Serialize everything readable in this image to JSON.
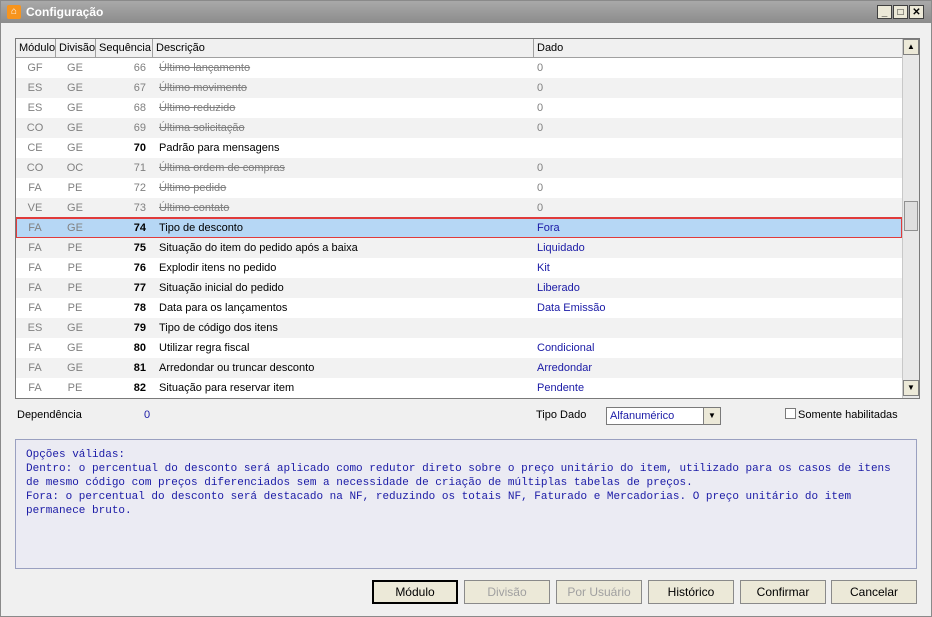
{
  "window": {
    "title": "Configuração"
  },
  "grid": {
    "columns": [
      "Módulo",
      "Divisão",
      "Sequência",
      "Descrição",
      "Dado"
    ],
    "rows": [
      {
        "mod": "GF",
        "div": "GE",
        "seq": "66",
        "desc": "Último lançamento",
        "val": "0",
        "state": "inactive"
      },
      {
        "mod": "ES",
        "div": "GE",
        "seq": "67",
        "desc": "Último movimento",
        "val": "0",
        "state": "inactive"
      },
      {
        "mod": "ES",
        "div": "GE",
        "seq": "68",
        "desc": "Último reduzido",
        "val": "0",
        "state": "inactive"
      },
      {
        "mod": "CO",
        "div": "GE",
        "seq": "69",
        "desc": "Última solicitação",
        "val": "0",
        "state": "inactive"
      },
      {
        "mod": "CE",
        "div": "GE",
        "seq": "70",
        "desc": "Padrão para mensagens",
        "val": "",
        "state": "active"
      },
      {
        "mod": "CO",
        "div": "OC",
        "seq": "71",
        "desc": "Última ordem de compras",
        "val": "0",
        "state": "inactive"
      },
      {
        "mod": "FA",
        "div": "PE",
        "seq": "72",
        "desc": "Último pedido",
        "val": "0",
        "state": "inactive"
      },
      {
        "mod": "VE",
        "div": "GE",
        "seq": "73",
        "desc": "Último contato",
        "val": "0",
        "state": "inactive"
      },
      {
        "mod": "FA",
        "div": "GE",
        "seq": "74",
        "desc": "Tipo de desconto",
        "val": "Fora",
        "state": "selected"
      },
      {
        "mod": "FA",
        "div": "PE",
        "seq": "75",
        "desc": "Situação do item do pedido após a baixa",
        "val": "Liquidado",
        "state": "active"
      },
      {
        "mod": "FA",
        "div": "PE",
        "seq": "76",
        "desc": "Explodir itens no pedido",
        "val": "Kit",
        "state": "active"
      },
      {
        "mod": "FA",
        "div": "PE",
        "seq": "77",
        "desc": "Situação inicial do pedido",
        "val": "Liberado",
        "state": "active"
      },
      {
        "mod": "FA",
        "div": "PE",
        "seq": "78",
        "desc": "Data para os lançamentos",
        "val": "Data Emissão",
        "state": "active"
      },
      {
        "mod": "ES",
        "div": "GE",
        "seq": "79",
        "desc": "Tipo de código dos itens",
        "val": "",
        "state": "active"
      },
      {
        "mod": "FA",
        "div": "GE",
        "seq": "80",
        "desc": "Utilizar regra fiscal",
        "val": "Condicional",
        "state": "active"
      },
      {
        "mod": "FA",
        "div": "GE",
        "seq": "81",
        "desc": "Arredondar ou truncar desconto",
        "val": "Arredondar",
        "state": "active"
      },
      {
        "mod": "FA",
        "div": "PE",
        "seq": "82",
        "desc": "Situação para reservar item",
        "val": "Pendente",
        "state": "active"
      }
    ]
  },
  "fields": {
    "dependencia_label": "Dependência",
    "dependencia_value": "0",
    "tipo_dado_label": "Tipo Dado",
    "tipo_dado_value": "Alfanumérico",
    "somente_label": "Somente habilitadas"
  },
  "memo": {
    "lines": [
      "Opções válidas:",
      "Dentro: o percentual do desconto será aplicado como redutor direto sobre o preço unitário do item, utilizado para os casos de itens de mesmo código com preços diferenciados sem a necessidade de criação de múltiplas tabelas de preços.",
      "Fora: o percentual do desconto será destacado na NF, reduzindo os totais NF, Faturado e Mercadorias. O preço unitário do item permanece bruto."
    ]
  },
  "buttons": {
    "modulo": "Módulo",
    "divisao": "Divisão",
    "por_usuario": "Por Usuário",
    "historico": "Histórico",
    "confirmar": "Confirmar",
    "cancelar": "Cancelar"
  },
  "icons": {
    "app": "app-icon",
    "minimize": "minimize-icon",
    "maximize": "maximize-icon",
    "close": "close-icon"
  }
}
